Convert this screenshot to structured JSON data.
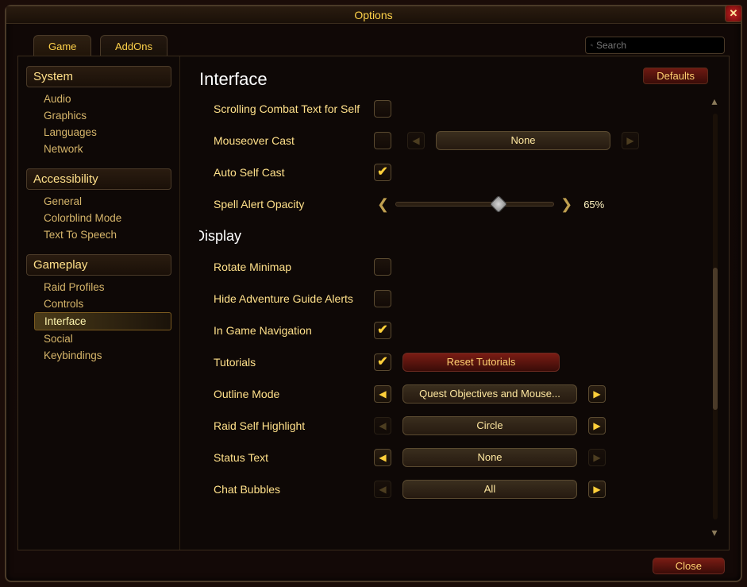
{
  "window": {
    "title": "Options"
  },
  "tabs": {
    "game": "Game",
    "addons": "AddOns"
  },
  "search": {
    "placeholder": "Search"
  },
  "sidebar": {
    "system": {
      "header": "System",
      "items": [
        "Audio",
        "Graphics",
        "Languages",
        "Network"
      ]
    },
    "accessibility": {
      "header": "Accessibility",
      "items": [
        "General",
        "Colorblind Mode",
        "Text To Speech"
      ]
    },
    "gameplay": {
      "header": "Gameplay",
      "items": [
        "Raid Profiles",
        "Controls",
        "Interface",
        "Social",
        "Keybindings"
      ],
      "active_index": 2
    }
  },
  "page": {
    "title": "Interface",
    "defaults": "Defaults",
    "close": "Close"
  },
  "settings": {
    "scrolling_combat": {
      "label": "Scrolling Combat Text for Self",
      "checked": false
    },
    "mouseover_cast": {
      "label": "Mouseover Cast",
      "checked": false,
      "value": "None"
    },
    "auto_self_cast": {
      "label": "Auto Self Cast",
      "checked": true
    },
    "spell_alert_opacity": {
      "label": "Spell Alert Opacity",
      "percent": 65,
      "display": "65%"
    },
    "display_header": "Display",
    "rotate_minimap": {
      "label": "Rotate Minimap",
      "checked": false
    },
    "hide_adv_guide": {
      "label": "Hide Adventure Guide Alerts",
      "checked": false
    },
    "in_game_nav": {
      "label": "In Game Navigation",
      "checked": true
    },
    "tutorials": {
      "label": "Tutorials",
      "checked": true,
      "reset_label": "Reset Tutorials"
    },
    "outline_mode": {
      "label": "Outline Mode",
      "value": "Quest Objectives and Mouse..."
    },
    "raid_self_highlight": {
      "label": "Raid Self Highlight",
      "value": "Circle"
    },
    "status_text": {
      "label": "Status Text",
      "value": "None"
    },
    "chat_bubbles": {
      "label": "Chat Bubbles",
      "value": "All"
    }
  }
}
